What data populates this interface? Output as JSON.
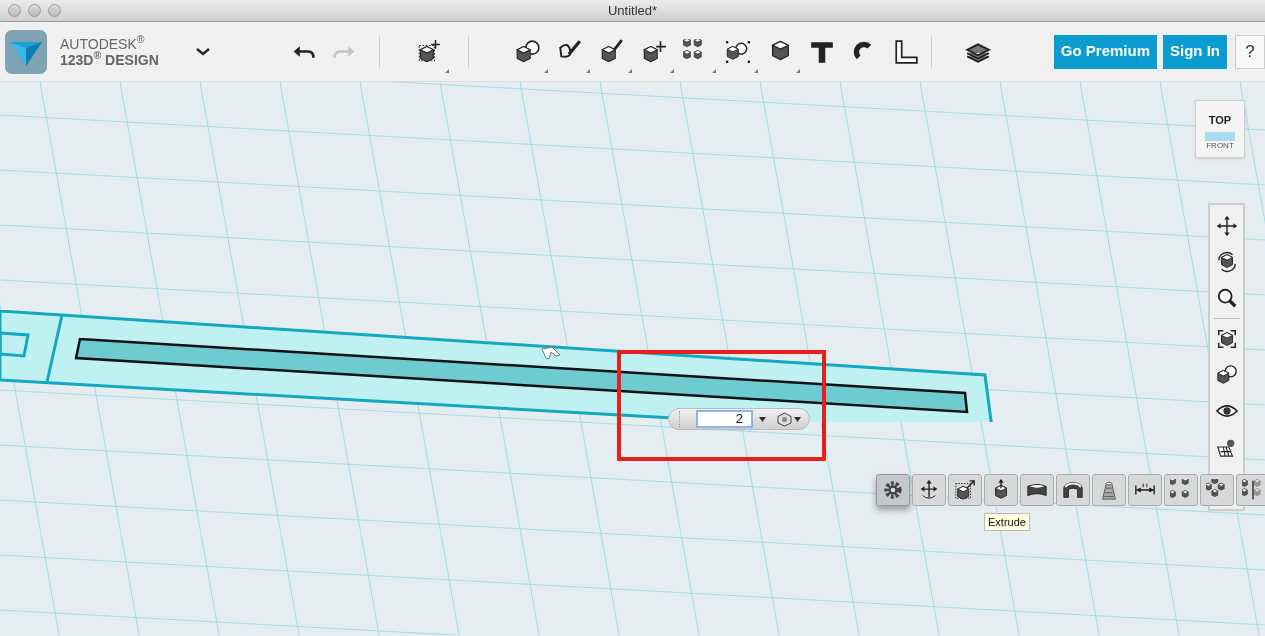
{
  "window": {
    "title": "Untitled*"
  },
  "logo": {
    "brand": "AUTODESK$^{®}$",
    "product": "123D$^{®}$ DESIGN"
  },
  "history": [
    {
      "kind": "undo",
      "disabled": false
    },
    {
      "kind": "redo",
      "disabled": true
    }
  ],
  "main_tools": [
    {
      "kind": "transform",
      "has_menu": true
    },
    {
      "kind": "primitives",
      "has_menu": true
    },
    {
      "kind": "sketch",
      "has_menu": true
    },
    {
      "kind": "construct",
      "has_menu": true
    },
    {
      "kind": "modify",
      "has_menu": true
    },
    {
      "kind": "pattern",
      "has_menu": true
    },
    {
      "kind": "grouping",
      "has_menu": true
    },
    {
      "kind": "combine",
      "has_menu": true
    },
    {
      "kind": "text",
      "has_menu": false
    },
    {
      "kind": "snap",
      "has_menu": false
    },
    {
      "kind": "measure",
      "has_menu": false
    },
    {
      "kind": "layers",
      "has_menu": false
    }
  ],
  "account_buttons": [
    "Go Premium",
    "Sign In"
  ],
  "help_button": "?",
  "view_cube": {
    "top": "TOP",
    "front": "FRONT"
  },
  "nav_tools": [
    {
      "kind": "pan"
    },
    {
      "kind": "orbit"
    },
    {
      "kind": "zoom"
    },
    {
      "kind": "fit"
    },
    {
      "kind": "material"
    },
    {
      "kind": "visibility"
    },
    {
      "kind": "grid"
    }
  ],
  "extrude_input": {
    "value": "2"
  },
  "edit_tools": [
    {
      "kind": "settings",
      "selected": true
    },
    {
      "kind": "move",
      "selected": false
    },
    {
      "kind": "scale",
      "selected": false
    },
    {
      "kind": "extrude",
      "selected": false
    },
    {
      "kind": "sweep",
      "selected": false
    },
    {
      "kind": "revolve",
      "selected": false
    },
    {
      "kind": "loft",
      "selected": false
    },
    {
      "kind": "dimension",
      "selected": false
    },
    {
      "kind": "rect-pattern",
      "selected": false
    },
    {
      "kind": "circ-pattern",
      "selected": false
    },
    {
      "kind": "mirror",
      "selected": false
    }
  ],
  "tooltip": "Extrude"
}
